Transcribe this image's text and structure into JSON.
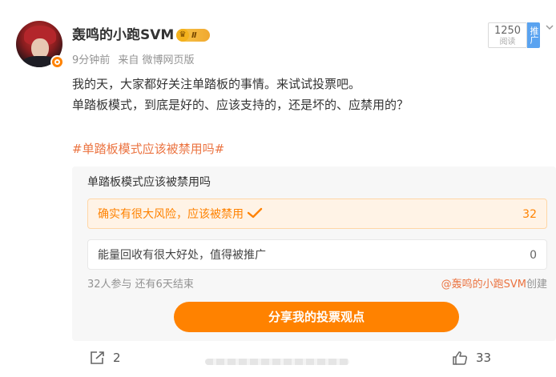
{
  "post": {
    "author": "轰鸣的小跑SVM",
    "level_badge": "Ⅱ",
    "time": "9分钟前",
    "source": "来自 微博网页版",
    "view_count": "1250",
    "view_label": "阅读",
    "push_label": "推广",
    "text_line1": "我的天，大家都好关注单踏板的事情。来试试投票吧。",
    "text_line2": "单踏板模式，到底是好的、应该支持的，还是坏的、应禁用的？",
    "hashtag": "#单踏板模式应该被禁用吗#"
  },
  "poll": {
    "title": "单踏板模式应该被禁用吗",
    "options": [
      {
        "label": "确实有很大风险，应该被禁用",
        "count": "32",
        "selected": true
      },
      {
        "label": "能量回收有很大好处，值得被推广",
        "count": "0",
        "selected": false
      }
    ],
    "participants": "32人参与",
    "remaining": "还有6天结束",
    "creator": "@轰鸣的小跑SVM",
    "creator_suffix": "创建",
    "share_label": "分享我的投票观点"
  },
  "footer": {
    "repost_count": "2",
    "like_count": "33"
  },
  "colors": {
    "accent": "#ff8200",
    "link": "#eb7340",
    "muted": "#939393"
  }
}
